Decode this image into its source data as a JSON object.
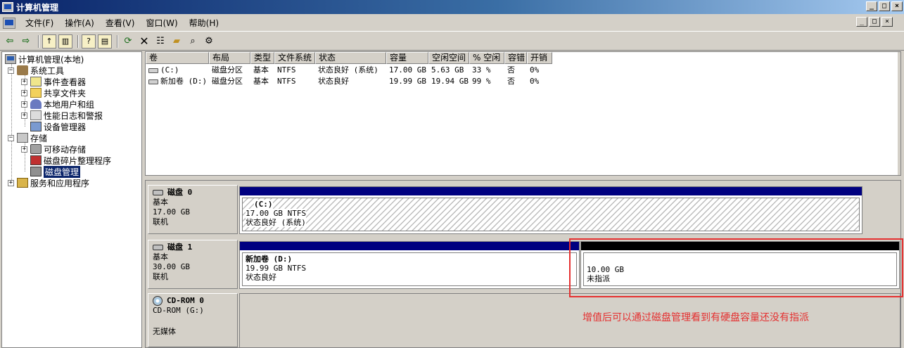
{
  "window": {
    "title": "计算机管理",
    "controls": [
      "_",
      "□",
      "×"
    ]
  },
  "menu": {
    "items": [
      "文件(F)",
      "操作(A)",
      "查看(V)",
      "窗口(W)",
      "帮助(H)"
    ],
    "mdi_controls": [
      "_",
      "□",
      "×"
    ]
  },
  "toolbar": {
    "buttons": [
      "back-arrow",
      "forward-arrow",
      "up-folder",
      "show-hide-tree",
      "help",
      "properties-pane",
      "refresh",
      "delete",
      "properties",
      "open-folder",
      "search",
      "disk-settings"
    ]
  },
  "tree": {
    "root": "计算机管理(本地)",
    "system_tools": "系统工具",
    "event_viewer": "事件查看器",
    "shared_folders": "共享文件夹",
    "local_users": "本地用户和组",
    "perf_logs": "性能日志和警报",
    "device_manager": "设备管理器",
    "storage": "存储",
    "removable_storage": "可移动存储",
    "defrag": "磁盘碎片整理程序",
    "disk_management": "磁盘管理",
    "services": "服务和应用程序"
  },
  "volume_list": {
    "columns": [
      "卷",
      "布局",
      "类型",
      "文件系统",
      "状态",
      "容量",
      "空闲空间",
      "% 空闲",
      "容错",
      "开销"
    ],
    "rows": [
      {
        "volume": "(C:)",
        "layout": "磁盘分区",
        "type": "基本",
        "fs": "NTFS",
        "status": "状态良好 (系统)",
        "capacity": "17.00 GB",
        "free": "5.63 GB",
        "pct_free": "33 %",
        "fault_tolerance": "否",
        "overhead": "0%"
      },
      {
        "volume": "新加卷 (D:)",
        "layout": "磁盘分区",
        "type": "基本",
        "fs": "NTFS",
        "status": "状态良好",
        "capacity": "19.99 GB",
        "free": "19.94 GB",
        "pct_free": "99 %",
        "fault_tolerance": "否",
        "overhead": "0%"
      }
    ]
  },
  "disks": {
    "disk0": {
      "name": "磁盘 0",
      "type": "基本",
      "size": "17.00 GB",
      "state": "联机",
      "partition": {
        "name": "(C:)",
        "size_fs": "17.00 GB NTFS",
        "status": "状态良好 (系统)"
      }
    },
    "disk1": {
      "name": "磁盘 1",
      "type": "基本",
      "size": "30.00 GB",
      "state": "联机",
      "partition": {
        "name": "新加卷  (D:)",
        "size_fs": "19.99 GB NTFS",
        "status": "状态良好"
      },
      "unallocated": {
        "size": "10.00 GB",
        "status": "未指派"
      }
    },
    "cdrom0": {
      "name": "CD-ROM 0",
      "drive": "CD-ROM (G:)",
      "status": "无媒体"
    }
  },
  "annotation": {
    "text": "增值后可以通过磁盘管理看到有硬盘容量还没有指派",
    "color": "#e53030"
  },
  "colors": {
    "titlebar": "#0a246a",
    "primary_partition": "#000080",
    "unallocated": "#000000",
    "selection": "#0a246a"
  }
}
